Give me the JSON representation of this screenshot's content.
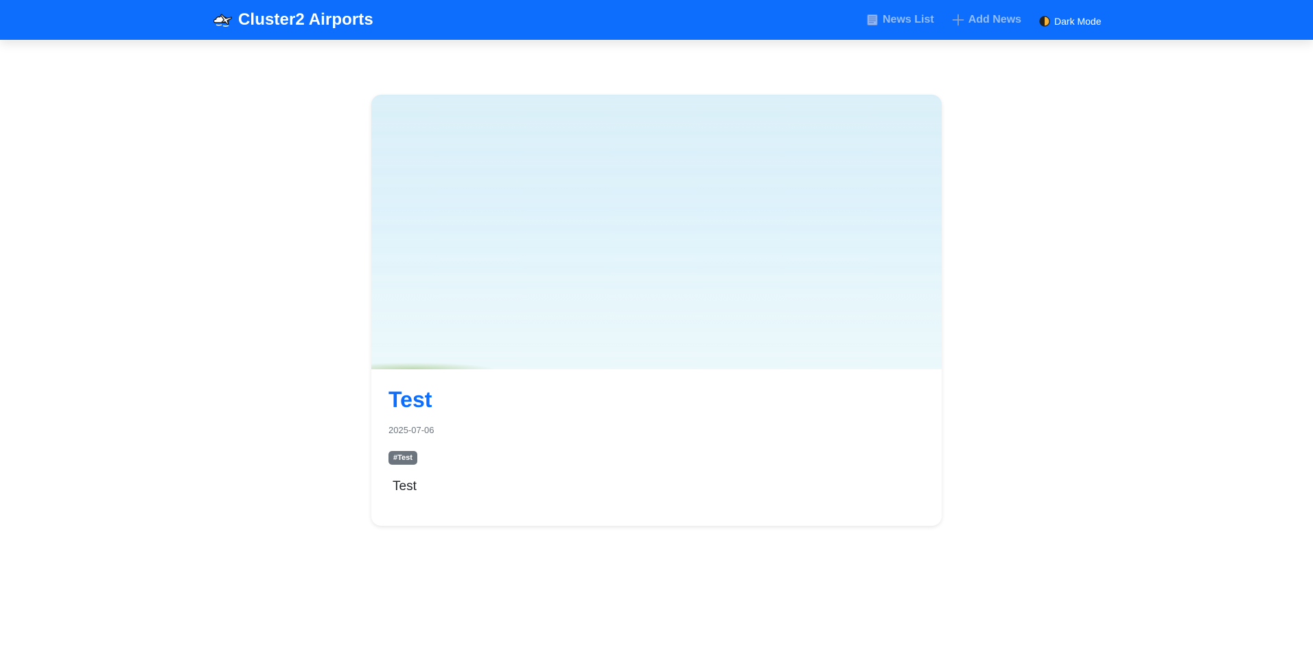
{
  "navbar": {
    "brand": "Cluster2 Airports",
    "brand_icon": "airplane-cloud-icon",
    "links": [
      {
        "label": "News List",
        "icon": "newspaper-icon"
      },
      {
        "label": "Add News",
        "icon": "plus-icon"
      }
    ],
    "dark_mode": {
      "label": "Dark Mode",
      "icon": "half-circle-icon"
    }
  },
  "article": {
    "title": "Test",
    "date": "2025-07-06",
    "tag": "#Test",
    "body": "Test"
  },
  "colors": {
    "primary": "#0d6efd",
    "tag_bg": "#6c757d",
    "date_text": "#6c757d"
  }
}
